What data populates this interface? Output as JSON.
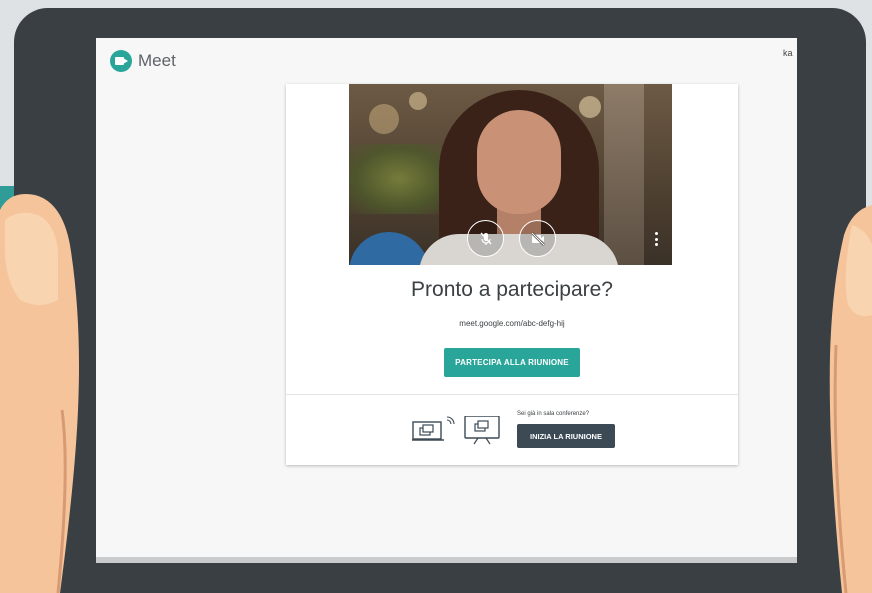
{
  "app": {
    "name": "Meet",
    "account_label": "ka"
  },
  "preview": {
    "mic_state": "muted",
    "camera_state": "off"
  },
  "main": {
    "heading": "Pronto a partecipare?",
    "meeting_url": "meet.google.com/abc-defg-hij",
    "join_button": "PARTECIPA ALLA RIUNIONE"
  },
  "conference_room": {
    "question": "Sei già in sala conferenze?",
    "start_button": "INIZIA LA RIUNIONE"
  },
  "colors": {
    "accent": "#2aa59a",
    "dark_button": "#3c4a56",
    "tablet_frame": "#3a3f44",
    "skin": "#f6c49a"
  },
  "icons": [
    "meet-logo-icon",
    "mic-off-icon",
    "camera-off-icon",
    "more-vert-icon",
    "laptop-cast-icon",
    "signal-icon",
    "room-display-icon"
  ]
}
